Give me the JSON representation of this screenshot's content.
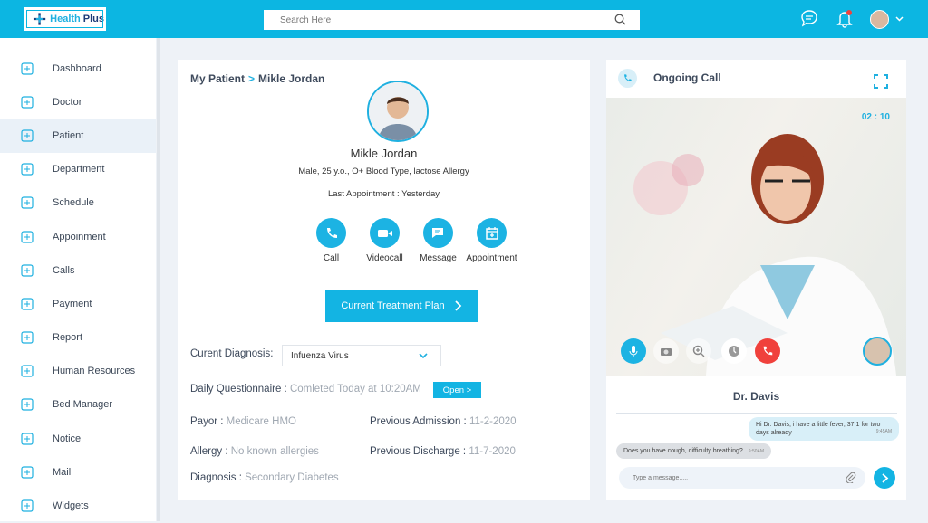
{
  "header": {
    "brand_part1": "Health",
    "brand_part2": "Plus",
    "search_placeholder": "Search Here"
  },
  "sidebar": {
    "items": [
      {
        "label": "Dashboard",
        "icon": "dashboard-icon"
      },
      {
        "label": "Doctor",
        "icon": "doctor-icon"
      },
      {
        "label": "Patient",
        "icon": "patient-icon",
        "active": true
      },
      {
        "label": "Department",
        "icon": "department-icon"
      },
      {
        "label": "Schedule",
        "icon": "schedule-icon"
      },
      {
        "label": "Appoinment",
        "icon": "appointment-icon"
      },
      {
        "label": "Calls",
        "icon": "phone-icon"
      },
      {
        "label": "Payment",
        "icon": "payment-icon"
      },
      {
        "label": "Report",
        "icon": "report-icon"
      },
      {
        "label": "Human Resources",
        "icon": "human-resources-icon"
      },
      {
        "label": "Bed Manager",
        "icon": "bed-icon"
      },
      {
        "label": "Notice",
        "icon": "notice-icon"
      },
      {
        "label": "Mail",
        "icon": "mail-icon"
      },
      {
        "label": "Widgets",
        "icon": "widgets-icon"
      }
    ]
  },
  "patient": {
    "breadcrumb_root": "My Patient",
    "breadcrumb_sep": ">",
    "breadcrumb_current": "Mikle Jordan",
    "name": "Mikle Jordan",
    "info": "Male, 25 y.o., O+ Blood Type, lactose  Allergy",
    "last_appointment": "Last Appointment : Yesterday",
    "actions": [
      "Call",
      "Videocall",
      "Message",
      "Appointment"
    ],
    "plan_button": "Current Treatment Plan",
    "diagnosis_label": "Curent Diagnosis:",
    "diagnosis_value": "Infuenza Virus",
    "questionnaire_label": "Daily Questionnaire :",
    "questionnaire_value": "Comleted Today at 10:20AM",
    "open_button": "Open >",
    "payor_label": "Payor :",
    "payor_value": "Medicare HMO",
    "allergy_label": "Allergy :",
    "allergy_value": "No known allergies",
    "diagnosis2_label": "Diagnosis :",
    "diagnosis2_value": "Secondary Diabetes",
    "prev_admission_label": "Previous Admission :",
    "prev_admission_value": "11-2-2020",
    "prev_discharge_label": "Previous Discharge :",
    "prev_discharge_value": "11-7-2020"
  },
  "call": {
    "title": "Ongoing Call",
    "timer": "02 : 10",
    "doctor": "Dr. Davis",
    "messages": [
      {
        "text": "Hi Dr. Davis, i have a little fever, 37,1 for two days already",
        "time": "9:45AM",
        "from": "patient"
      },
      {
        "text": "Does you have cough, difficulty breathing?",
        "time": "9:50AM",
        "from": "doctor"
      }
    ],
    "compose_placeholder": "Type a message....."
  },
  "colors": {
    "accent": "#0cb6e2",
    "end_call": "#f0413c"
  }
}
